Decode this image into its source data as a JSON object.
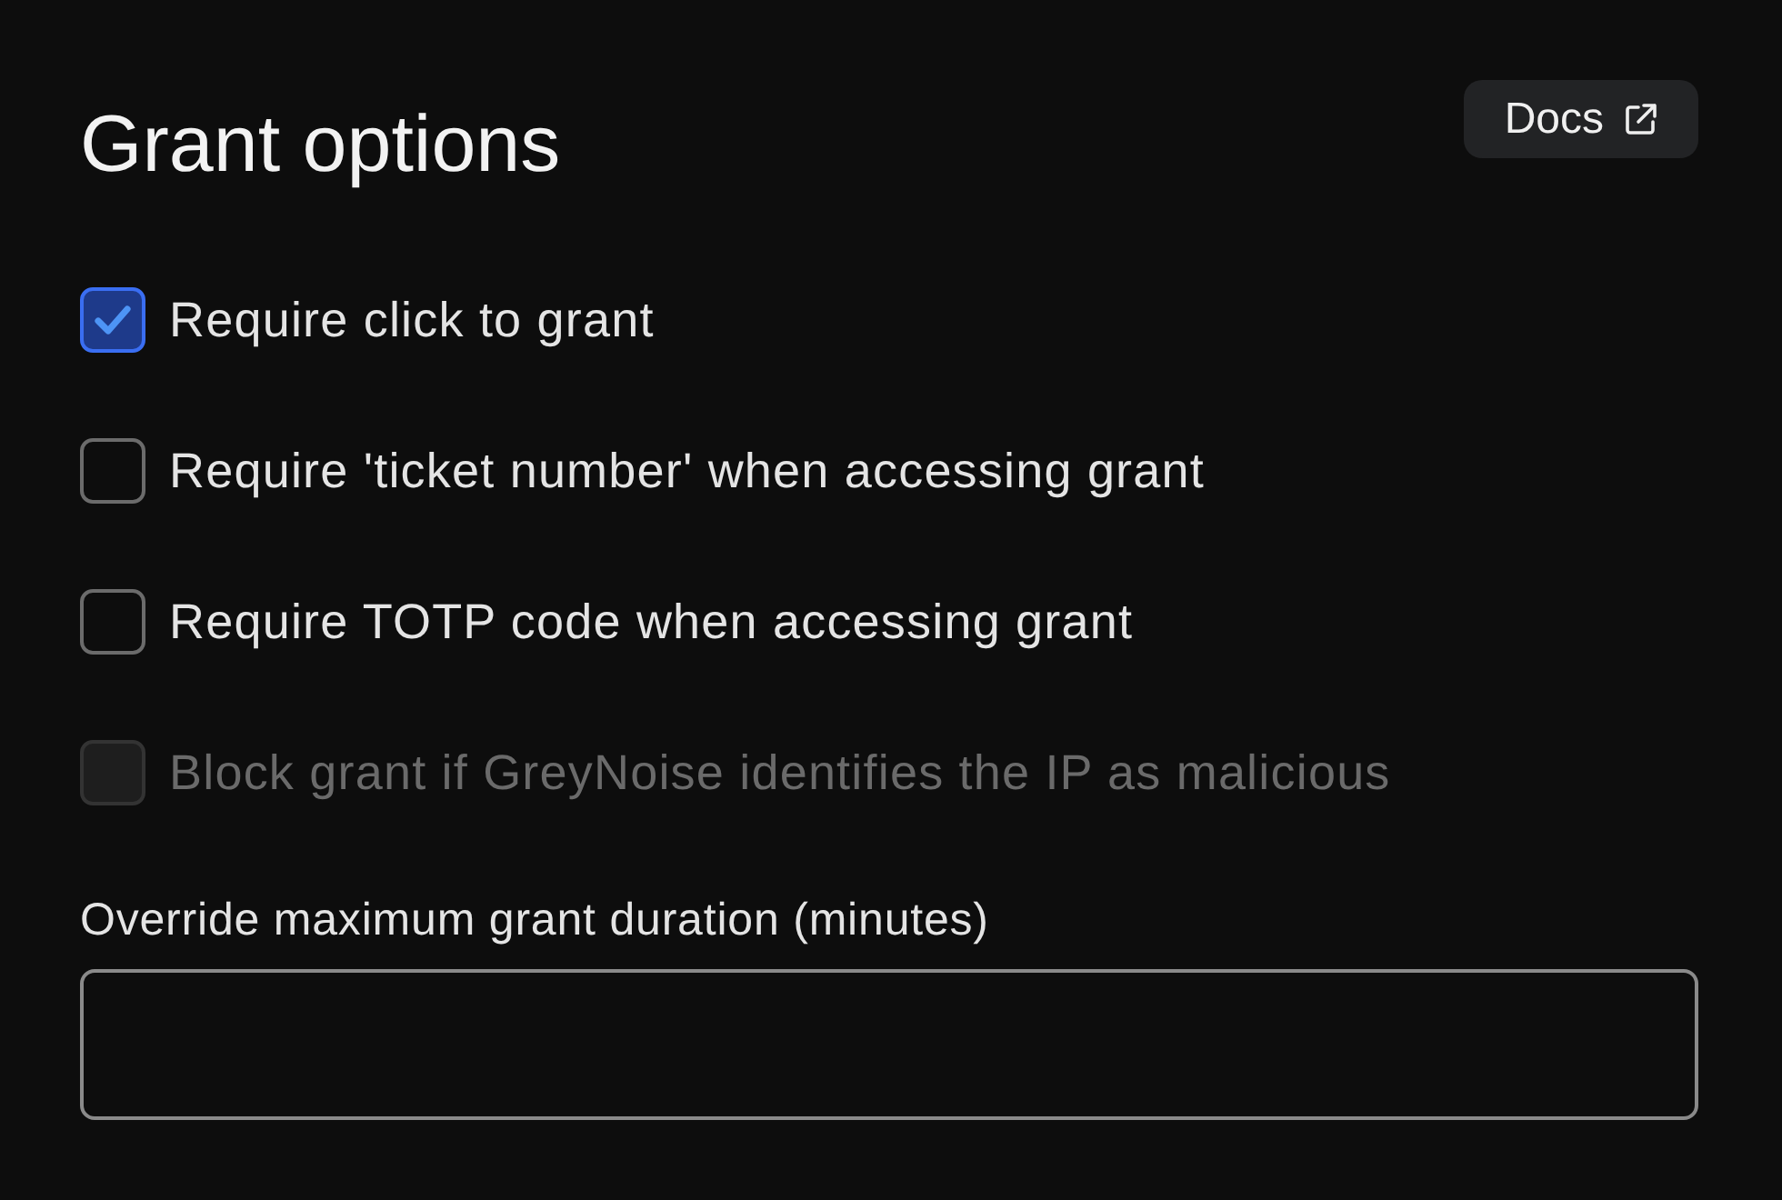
{
  "header": {
    "title": "Grant options",
    "docs_button": {
      "label": "Docs"
    }
  },
  "options": [
    {
      "label": "Require click to grant",
      "checked": true,
      "disabled": false
    },
    {
      "label": "Require 'ticket number' when accessing grant",
      "checked": false,
      "disabled": false
    },
    {
      "label": "Require TOTP code when accessing grant",
      "checked": false,
      "disabled": false
    },
    {
      "label": "Block grant if GreyNoise identifies the IP as malicious",
      "checked": false,
      "disabled": true
    }
  ],
  "duration_field": {
    "label": "Override maximum grant duration (minutes)"
  }
}
